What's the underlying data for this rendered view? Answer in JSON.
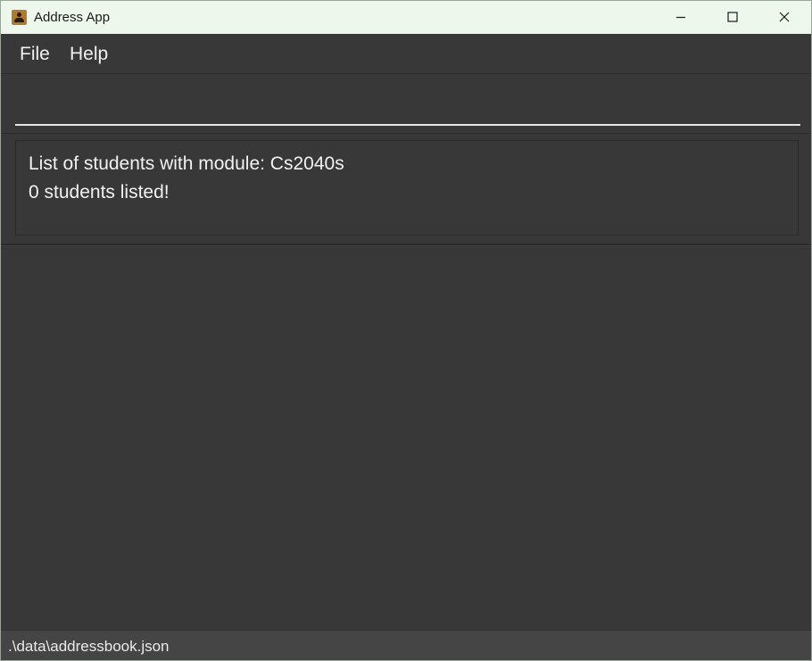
{
  "window": {
    "title": "Address App",
    "icon": "address-book-icon"
  },
  "title_controls": {
    "minimize_icon": "minimize-icon",
    "maximize_icon": "maximize-icon",
    "close_icon": "close-icon"
  },
  "menubar": {
    "items": [
      {
        "label": "File"
      },
      {
        "label": "Help"
      }
    ]
  },
  "command_box": {
    "value": "",
    "placeholder": ""
  },
  "result_display": {
    "lines": [
      "List of students with module: Cs2040s",
      "0 students listed!"
    ]
  },
  "student_list": {
    "items": []
  },
  "statusbar": {
    "save_location": ".\\data\\addressbook.json"
  },
  "colors": {
    "background": "#383838",
    "titlebar": "#eef7eb",
    "statusbar": "#454545",
    "text": "#f0f0f0"
  }
}
